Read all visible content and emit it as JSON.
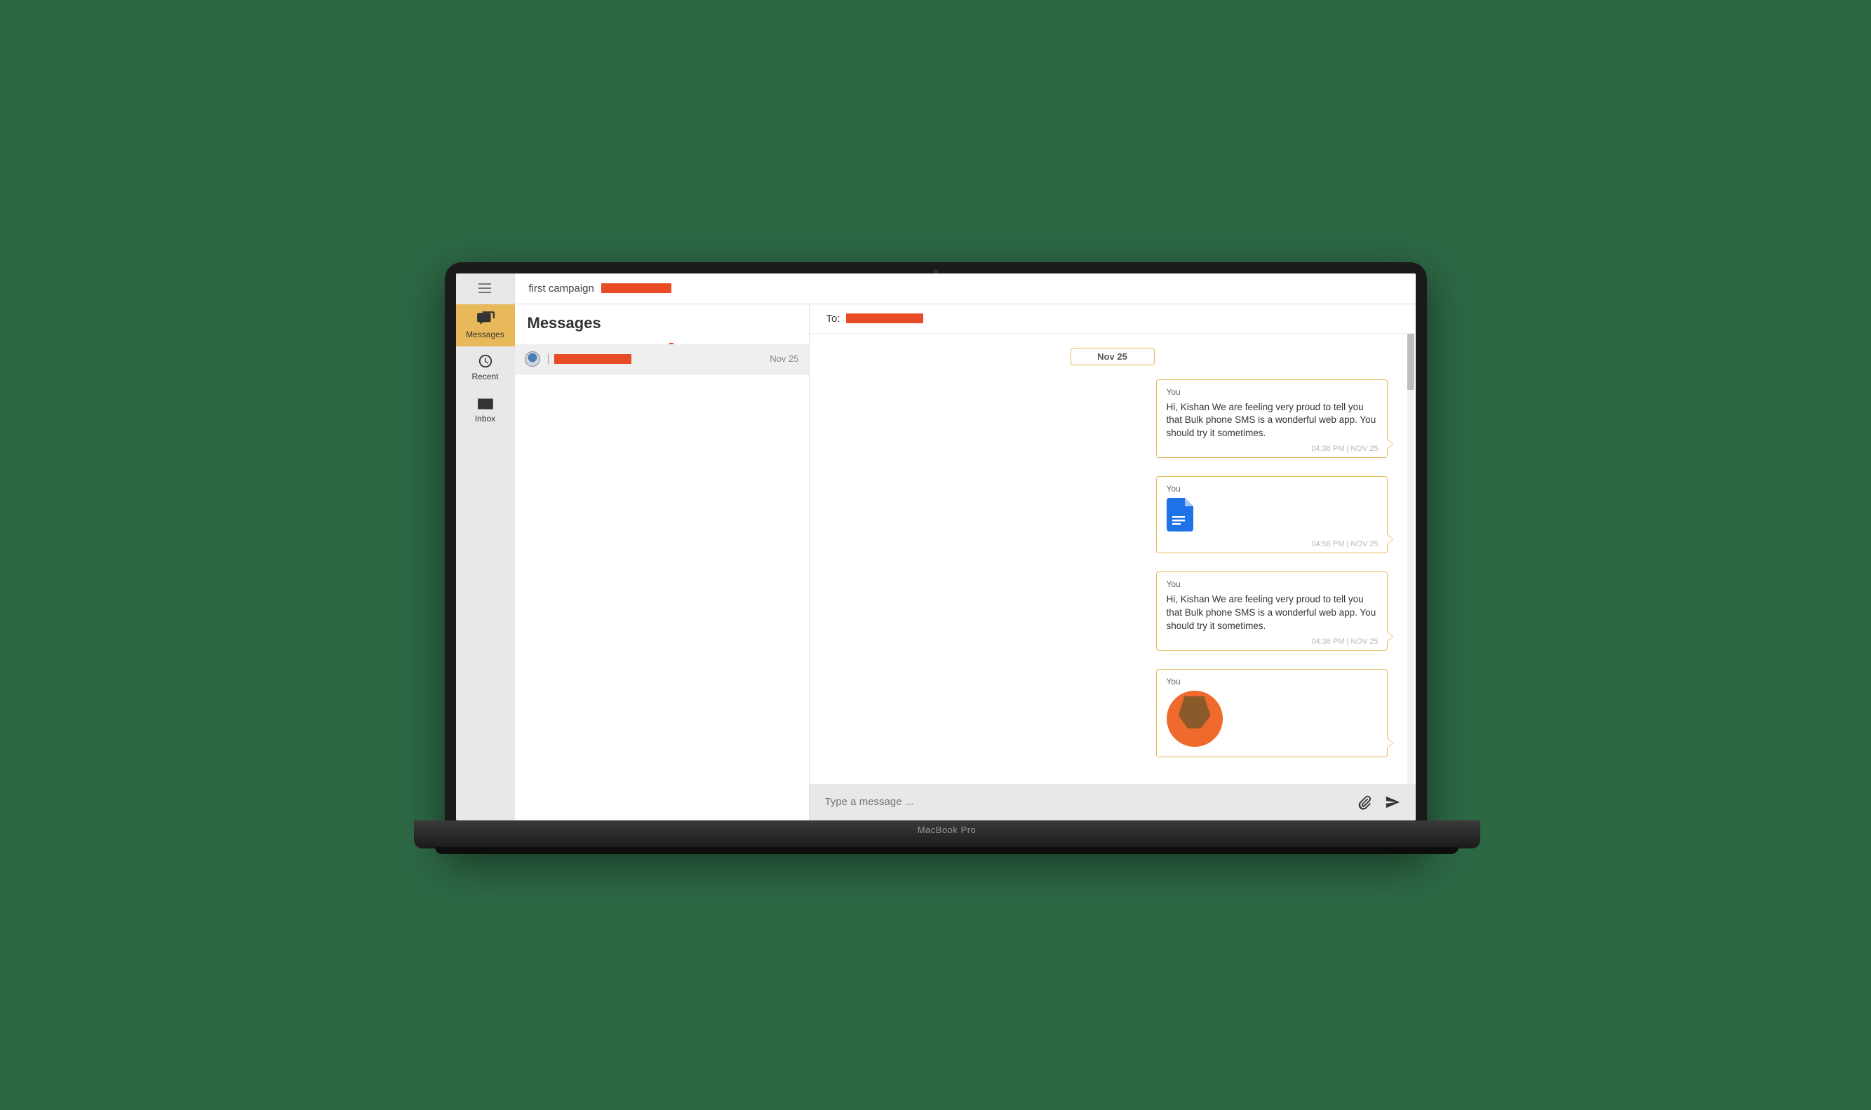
{
  "topbar": {
    "campaign_label": "first campaign"
  },
  "sidebar": {
    "items": [
      {
        "label": "Messages"
      },
      {
        "label": "Recent"
      },
      {
        "label": "Inbox"
      }
    ]
  },
  "msglist": {
    "title": "Messages",
    "conversations": [
      {
        "date": "Nov 25"
      }
    ]
  },
  "chat": {
    "to_label": "To:",
    "date_separator": "Nov 25",
    "messages": [
      {
        "sender": "You",
        "body": "Hi, Kishan We are feeling very proud to tell you that Bulk phone SMS is a wonderful web app. You should try it sometimes.",
        "timestamp": "04:36 PM | NOV 25",
        "type": "text"
      },
      {
        "sender": "You",
        "timestamp": "04:56 PM | NOV 25",
        "type": "document"
      },
      {
        "sender": "You",
        "body": "Hi, Kishan We are feeling very proud to tell you that Bulk phone SMS is a wonderful web app. You should try it sometimes.",
        "timestamp": "04:36 PM | NOV 25",
        "type": "text"
      },
      {
        "sender": "You",
        "type": "image"
      }
    ],
    "compose_placeholder": "Type a message ..."
  },
  "device": {
    "model": "MacBook Pro"
  }
}
